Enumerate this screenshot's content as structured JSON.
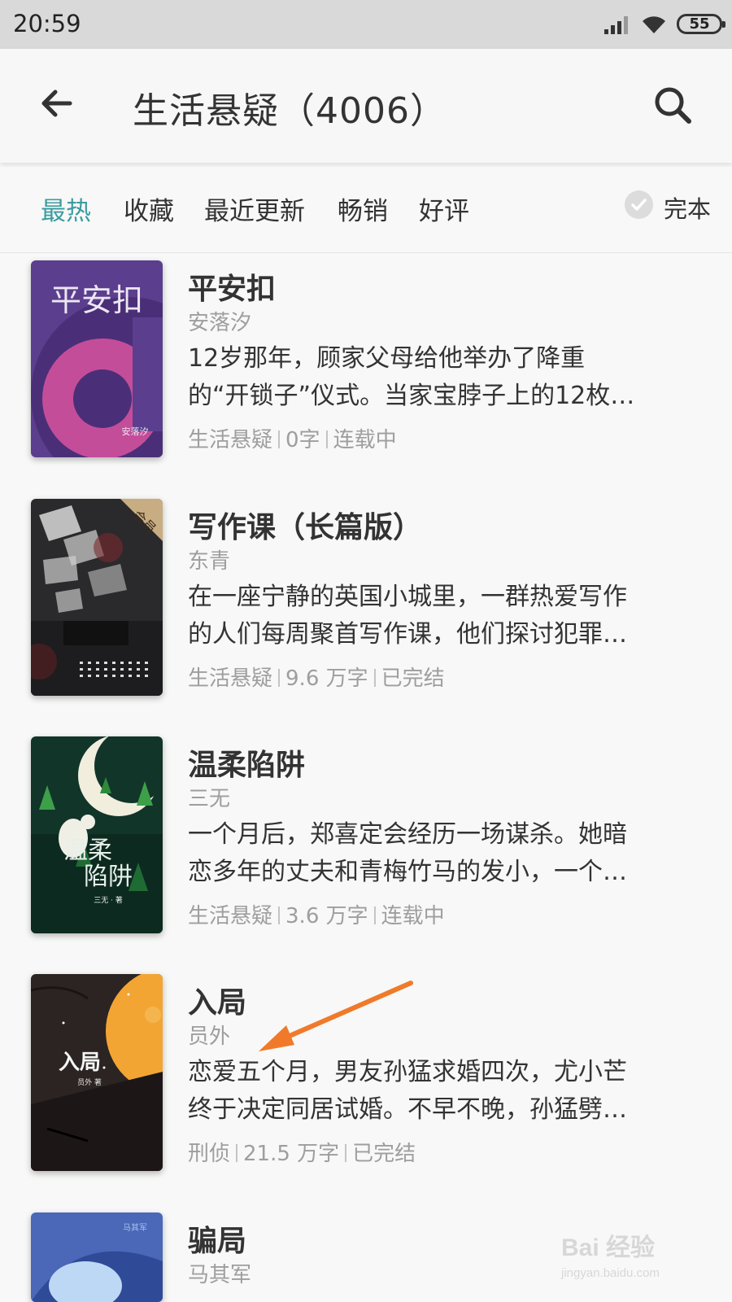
{
  "status_bar": {
    "time": "20:59",
    "battery": "55"
  },
  "header": {
    "title": "生活悬疑（4006）"
  },
  "filters": {
    "tabs": [
      "最热",
      "收藏",
      "最近更新",
      "畅销",
      "好评"
    ],
    "complete_label": "完本"
  },
  "books": [
    {
      "title": "平安扣",
      "author": "安落汐",
      "desc_line1": "12岁那年，顾家父母给他举办了降重",
      "desc_line2": "的“开锁子”仪式。当家宝脖子上的12枚…",
      "category": "生活悬疑",
      "words": "0字",
      "status": "连载中",
      "cover_title": "平安扣",
      "cover_author": "安落汐"
    },
    {
      "title": "写作课（长篇版）",
      "author": "东青",
      "desc_line1": "在一座宁静的英国小城里，一群热爱写作",
      "desc_line2": "的人们每周聚首写作课，他们探讨犯罪…",
      "category": "生活悬疑",
      "words": "9.6 万字",
      "status": "已完结",
      "cover_badge": "会员"
    },
    {
      "title": "温柔陷阱",
      "author": "三无",
      "desc_line1": "一个月后，郑喜定会经历一场谋杀。她暗",
      "desc_line2": "恋多年的丈夫和青梅竹马的发小，一个…",
      "category": "生活悬疑",
      "words": "3.6 万字",
      "status": "连载中",
      "cover_title_1": "温柔",
      "cover_title_2": "陷阱",
      "cover_author": "三无 · 著"
    },
    {
      "title": "入局",
      "author": "员外",
      "desc_line1": "恋爱五个月，男友孙猛求婚四次，尤小芒",
      "desc_line2": "终于决定同居试婚。不早不晚，孙猛劈…",
      "category": "刑侦",
      "words": "21.5 万字",
      "status": "已完结",
      "cover_title": "入局",
      "cover_author": "员外 著"
    },
    {
      "title": "骗局",
      "author": "马其军",
      "cover_author": "马其军"
    }
  ],
  "watermark": {
    "brand": "Bai 经验",
    "url": "jingyan.baidu.com"
  },
  "colors": {
    "accent": "#3d9ba0",
    "annotation_arrow": "#f07a2a"
  }
}
